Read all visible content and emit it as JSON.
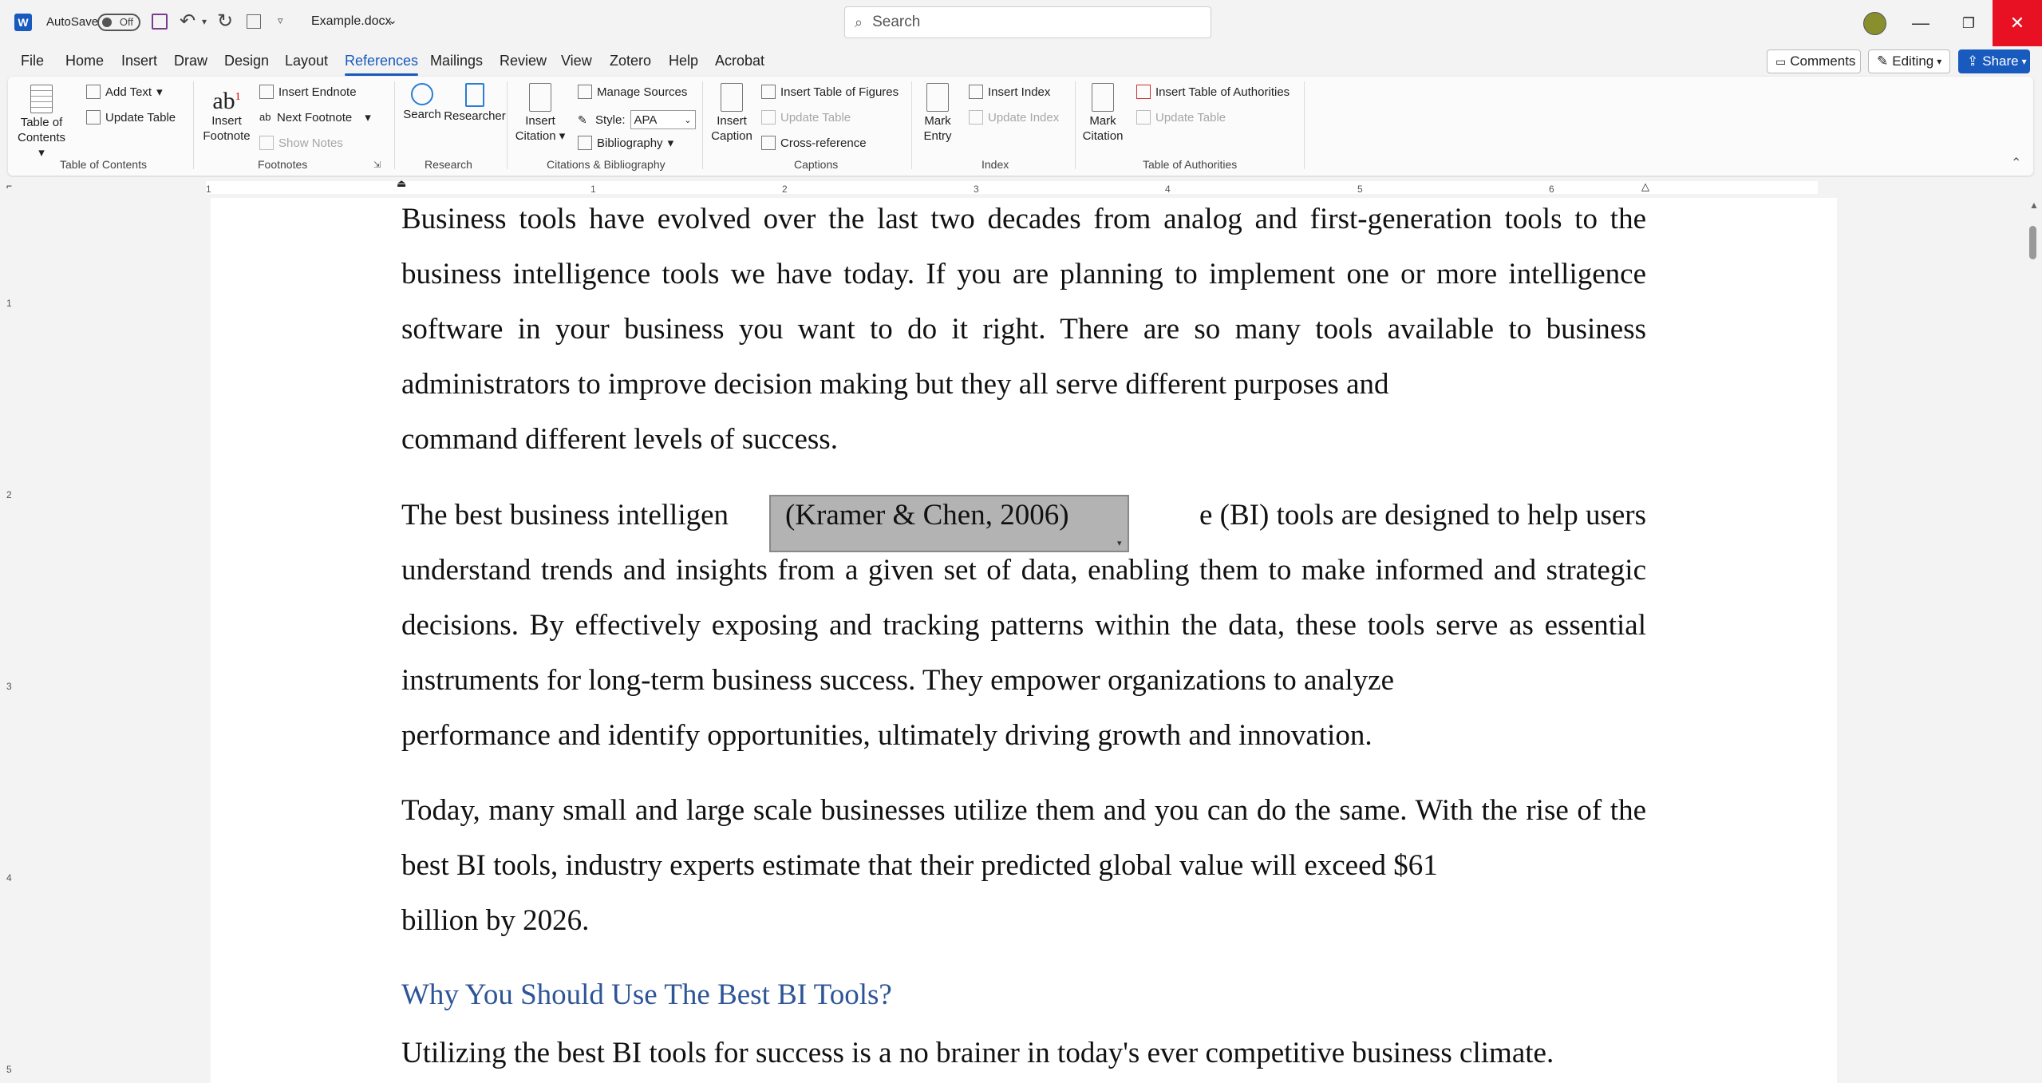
{
  "titlebar": {
    "autosave_label": "AutoSave",
    "autosave_state": "Off",
    "filename": "Example.docx",
    "search_placeholder": "Search"
  },
  "tabs": [
    "File",
    "Home",
    "Insert",
    "Draw",
    "Design",
    "Layout",
    "References",
    "Mailings",
    "Review",
    "View",
    "Zotero",
    "Help",
    "Acrobat"
  ],
  "active_tab": "References",
  "right_buttons": {
    "comments": "Comments",
    "editing": "Editing",
    "share": "Share"
  },
  "ribbon": {
    "toc": {
      "table_of_contents": "Table of Contents",
      "add_text": "Add Text",
      "update_table": "Update Table",
      "group": "Table of Contents"
    },
    "footnotes": {
      "insert_footnote": "Insert Footnote",
      "insert_endnote": "Insert Endnote",
      "next_footnote": "Next Footnote",
      "show_notes": "Show Notes",
      "group": "Footnotes"
    },
    "research": {
      "search": "Search",
      "researcher": "Researcher",
      "group": "Research"
    },
    "citations": {
      "insert_citation": "Insert Citation",
      "manage_sources": "Manage Sources",
      "style_label": "Style:",
      "style_value": "APA",
      "bibliography": "Bibliography",
      "group": "Citations & Bibliography"
    },
    "captions": {
      "insert_caption": "Insert Caption",
      "insert_table_of_figures": "Insert Table of Figures",
      "update_table": "Update Table",
      "cross_reference": "Cross-reference",
      "group": "Captions"
    },
    "index": {
      "mark_entry": "Mark Entry",
      "insert_index": "Insert Index",
      "update_index": "Update Index",
      "group": "Index"
    },
    "authorities": {
      "mark_citation": "Mark Citation",
      "insert_table_of_authorities": "Insert Table of Authorities",
      "update_table": "Update Table",
      "group": "Table of Authorities"
    }
  },
  "ruler_numbers": [
    "1",
    "1",
    "2",
    "3",
    "4",
    "5",
    "6"
  ],
  "vruler_numbers": [
    "1",
    "2",
    "3",
    "4",
    "5"
  ],
  "document": {
    "p1": "Business tools have evolved over the last two decades from analog and first-generation tools to the business intelligence tools we have today.  If you are planning to implement one or more intelligence software in your business you want to do it right. There are so many tools available to business administrators to improve decision making but they all serve different purposes and",
    "p1_last": "command different levels of success.",
    "p2_start": "The best business intelligen",
    "citation": "(Kramer & Chen, 2006)",
    "p2_end": "e (BI) tools are designed to help users",
    "p2": "understand trends and insights from a given set of data, enabling them to make informed and strategic decisions. By effectively exposing and tracking patterns within the data, these tools serve as essential instruments for long-term business success. They empower organizations to analyze",
    "p2_last": "performance and identify opportunities, ultimately driving growth and innovation.",
    "p3": "Today, many small and large scale businesses utilize them and you can do the same. With the rise of the best BI tools, industry experts estimate that their predicted global value will exceed $61",
    "p3_last": "billion by 2026.",
    "heading": "Why You Should Use The Best BI Tools?",
    "p4": "Utilizing the best BI tools for success is a no brainer in today's ever competitive business climate."
  },
  "colors": {
    "accent": "#185abd",
    "close": "#e81123",
    "heading": "#2e5597"
  }
}
